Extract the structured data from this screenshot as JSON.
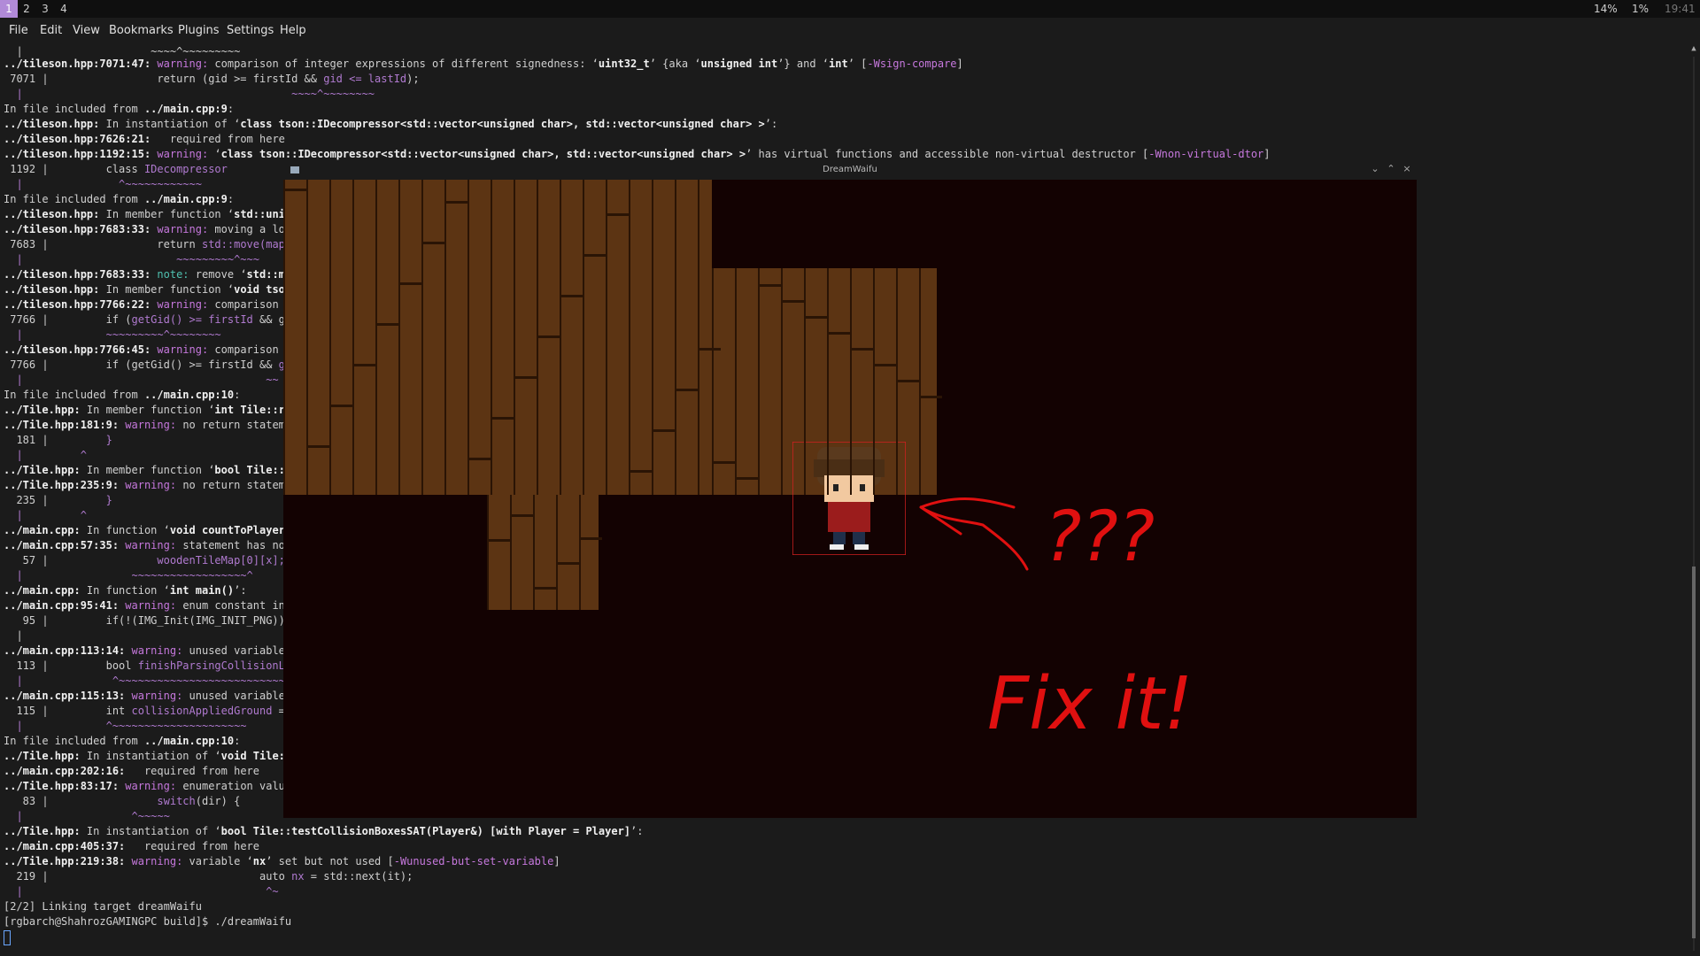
{
  "workspaces": [
    "1",
    "2",
    "3",
    "4"
  ],
  "status": {
    "cpu": "14%",
    "mem": "1%",
    "time": "19:41"
  },
  "menu": [
    "File",
    "Edit",
    "View",
    "Bookmarks",
    "Plugins",
    "Settings",
    "Help"
  ],
  "game_window": {
    "title": "DreamWaifu"
  },
  "annotation": {
    "question": "???",
    "fix": "Fix it!"
  },
  "terminal": {
    "l0": "  |                    ~~~~^~~~~~~~~~",
    "l1a": "../tileson.hpp:7071:47: ",
    "l1w": "warning: ",
    "l1t": "comparison of integer expressions of different signedness: ‘",
    "l1b1": "uint32_t",
    "l1t2": "’ {aka ‘",
    "l1b2": "unsigned int",
    "l1t3": "’} and ‘",
    "l1b3": "int",
    "l1t4": "’ [",
    "l1f": "-Wsign-compare",
    "l1t5": "]",
    "l2": " 7071 |                 return (gid >= firstId && ",
    "l2p": "gid <= lastId",
    "l2e": ");",
    "l3": "  |                                          ~~~~^~~~~~~~~",
    "l4a": "In file included from ",
    "l4b": "../main.cpp:9",
    "l4c": ":",
    "l5a": "../tileson.hpp:",
    "l5t": " In instantiation of ‘",
    "l5b": "class tson::IDecompressor<std::vector<unsigned char>, std::vector<unsigned char> >",
    "l5e": "’:",
    "l6a": "../tileson.hpp:7626:21:",
    "l6t": "   required from here",
    "l7a": "../tileson.hpp:1192:15: ",
    "l7w": "warning: ",
    "l7t": "‘",
    "l7b": "class tson::IDecompressor<std::vector<unsigned char>, std::vector<unsigned char> >",
    "l7t2": "’ has virtual functions and accessible non-virtual destructor [",
    "l7f": "-Wnon-virtual-dtor",
    "l7e": "]",
    "l8": " 1192 |         class ",
    "l8p": "IDecompressor",
    "l9": "  |               ^~~~~~~~~~~~~",
    "l10a": "In file included from ",
    "l10b": "../main.cpp:9",
    "l10c": ":",
    "l11a": "../tileson.hpp:",
    "l11t": " In member function ‘",
    "l11b": "std::uniq",
    "l12a": "../tileson.hpp:7683:33: ",
    "l12w": "warning: ",
    "l12t": "moving a loc",
    "l13": " 7683 |                 return ",
    "l13p": "std::move(map)",
    "l14": "  |                        ~~~~~~~~~^~~~",
    "l15a": "../tileson.hpp:7683:33: ",
    "l15n": "note: ",
    "l15t": "remove ‘",
    "l15b": "std::mo",
    "l16a": "../tileson.hpp:",
    "l16t": " In member function ‘",
    "l16b": "void tson",
    "l17a": "../tileson.hpp:7766:22: ",
    "l17w": "warning: ",
    "l17t": "comparison o",
    "l18": " 7766 |         if (",
    "l18p": "getGid() >= firstId",
    "l18e": " && ge",
    "l19": "  |             ~~~~~~~~~^~~~~~~~~",
    "l20a": "../tileson.hpp:7766:45: ",
    "l20w": "warning: ",
    "l20t": "comparison o",
    "l21": " 7766 |         if (getGid() >= firstId && ",
    "l21p": "ge",
    "l22": "  |                                      ~~",
    "l23a": "In file included from ",
    "l23b": "../main.cpp:10",
    "l23c": ":",
    "l24a": "../Tile.hpp:",
    "l24t": " In member function ‘",
    "l24b": "int Tile::re",
    "l25a": "../Tile.hpp:181:9: ",
    "l25w": "warning: ",
    "l25t": "no return stateme",
    "l26": "  181 |         ",
    "l26p": "}",
    "l27": "  |         ^",
    "l28a": "../Tile.hpp:",
    "l28t": " In member function ‘",
    "l28b": "bool Tile::t",
    "l29a": "../Tile.hpp:235:9: ",
    "l29w": "warning: ",
    "l29t": "no return stateme",
    "l30": "  235 |         ",
    "l30p": "}",
    "l31": "  |         ^",
    "l32a": "../main.cpp:",
    "l32t": " In function ‘",
    "l32b": "void countToPlayerI",
    "l33a": "../main.cpp:57:35: ",
    "l33w": "warning: ",
    "l33t": "statement has no",
    "l34": "   57 |                 ",
    "l34p": "woodenTileMap[0][x];",
    "l35": "  |                 ~~~~~~~~~~~~~~~~~~^",
    "l36a": "../main.cpp:",
    "l36t": " In function ‘",
    "l36b": "int main()",
    "l36e": "’:",
    "l37a": "../main.cpp:95:41: ",
    "l37w": "warning: ",
    "l37t": "enum constant in",
    "l38": "   95 |         if(!(IMG_Init(IMG_INIT_PNG)) ",
    "l39": "  |",
    "l40a": "../main.cpp:113:14: ",
    "l40w": "warning: ",
    "l40t": "unused variable",
    "l41": "  113 |         bool ",
    "l41p": "finishParsingCollisionLa",
    "l42": "  |              ^~~~~~~~~~~~~~~~~~~~~~~~~~~",
    "l43a": "../main.cpp:115:13: ",
    "l43w": "warning: ",
    "l43t": "unused variable",
    "l44": "  115 |         int ",
    "l44p": "collisionAppliedGround",
    "l44e": " =",
    "l45": "  |             ^~~~~~~~~~~~~~~~~~~~~~",
    "l46a": "In file included from ",
    "l46b": "../main.cpp:10",
    "l46c": ":",
    "l47a": "../Tile.hpp:",
    "l47t": " In instantiation of ‘",
    "l47b": "void Tile::",
    "l48a": "../main.cpp:202:16:",
    "l48t": "   required from here",
    "l49a": "../Tile.hpp:83:17: ",
    "l49w": "warning: ",
    "l49t": "enumeration value",
    "l50": "   83 |                 ",
    "l50p": "switch",
    "l50e": "(dir) {",
    "l51": "  |                 ^~~~~~",
    "l52a": "../Tile.hpp:",
    "l52t": " In instantiation of ‘",
    "l52b": "bool Tile::testCollisionBoxesSAT(Player&) [with Player = Player]",
    "l52e": "’:",
    "l53a": "../main.cpp:405:37:",
    "l53t": "   required from here",
    "l54a": "../Tile.hpp:219:38: ",
    "l54w": "warning: ",
    "l54t": "variable ‘",
    "l54b": "nx",
    "l54t2": "’ set but not used [",
    "l54f": "-Wunused-but-set-variable",
    "l54e": "]",
    "l55": "  219 |                                 auto ",
    "l55p": "nx",
    "l55e": " = std::next(it);",
    "l56": "  |                                      ^~",
    "l57": "[2/2] Linking target dreamWaifu",
    "l58": "[rgbarch@ShahrozGAMINGPC build]$ ./dreamWaifu"
  }
}
